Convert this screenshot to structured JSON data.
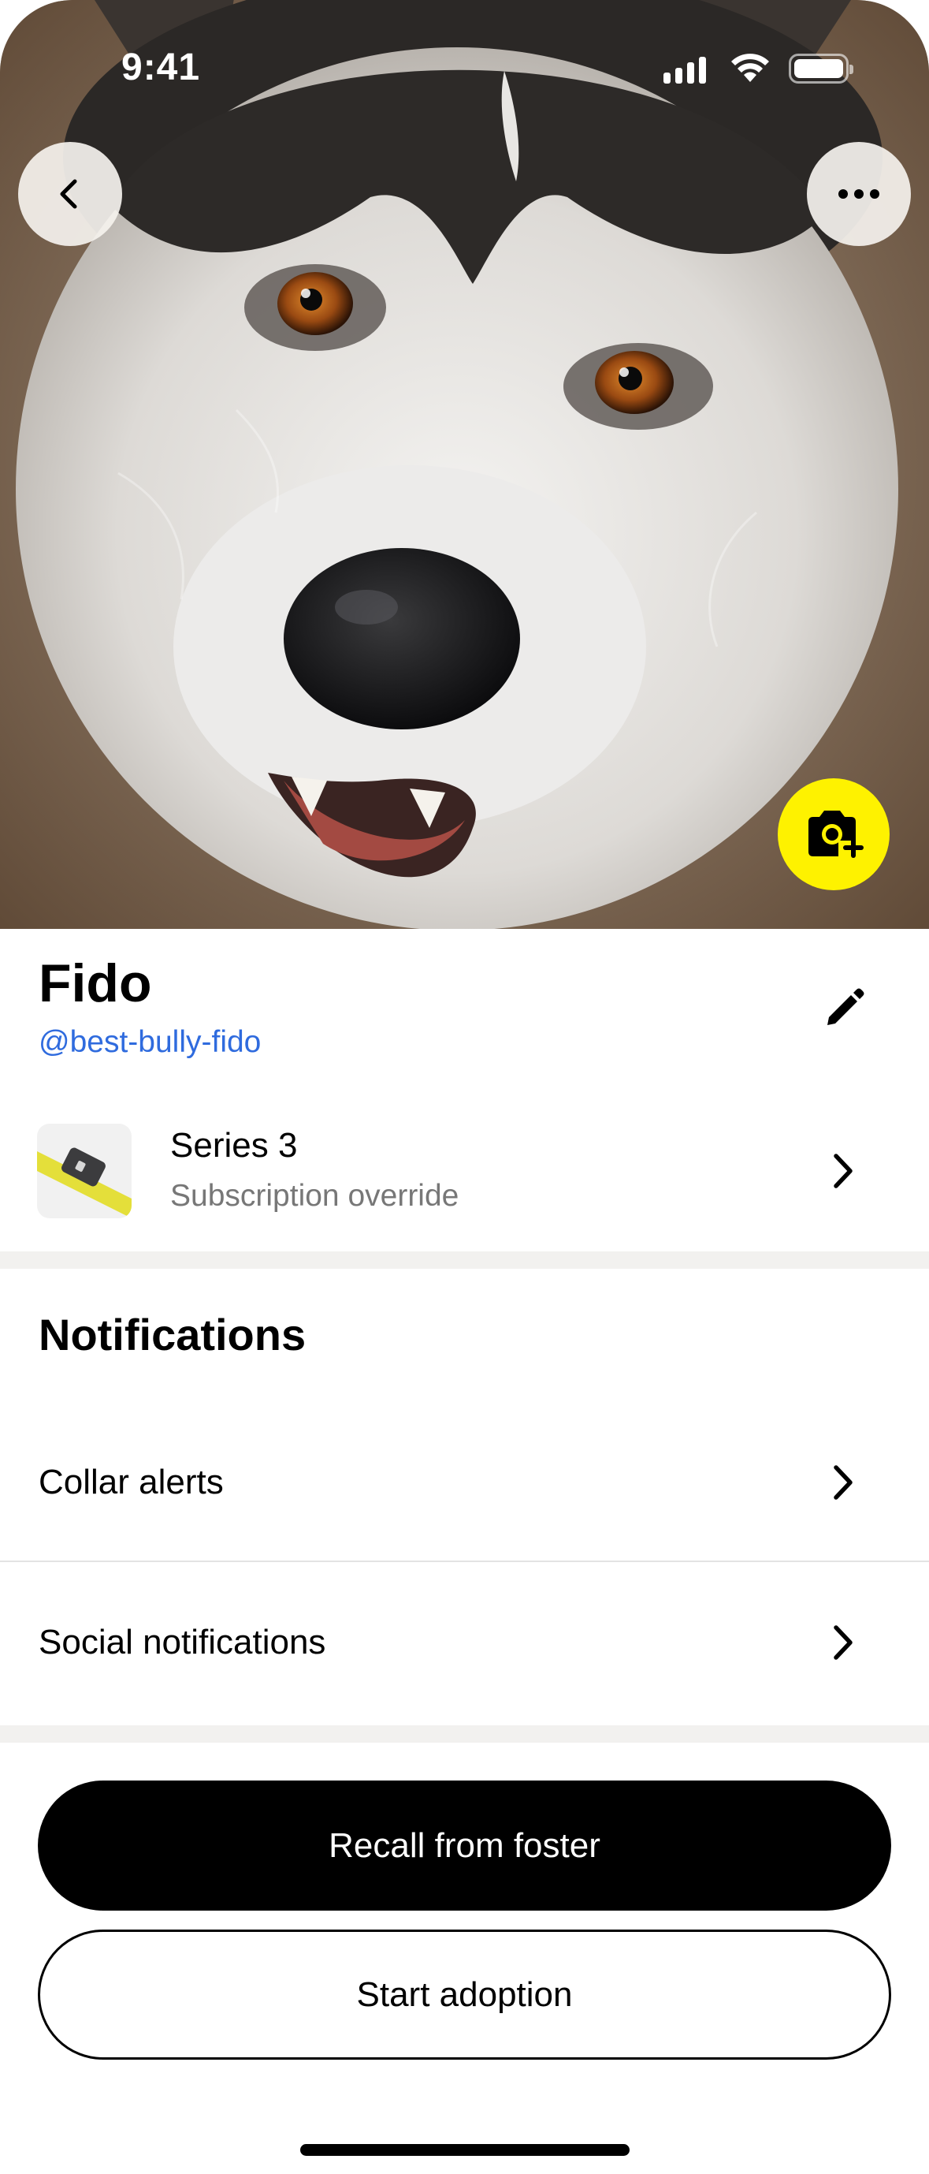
{
  "status_bar": {
    "time": "9:41"
  },
  "hero": {
    "photo": "husky-dog-photo"
  },
  "header": {
    "back_icon": "chevron-left-icon",
    "more_icon": "ellipsis-icon",
    "camera_icon": "camera-plus-icon"
  },
  "profile": {
    "name": "Fido",
    "handle": "@best-bully-fido",
    "edit_icon": "pencil-icon"
  },
  "device": {
    "title": "Series 3",
    "subtitle": "Subscription override"
  },
  "notifications": {
    "title": "Notifications",
    "items": [
      {
        "label": "Collar alerts"
      },
      {
        "label": "Social notifications"
      }
    ]
  },
  "actions": {
    "primary_label": "Recall from foster",
    "secondary_label": "Start adoption"
  },
  "colors": {
    "accent_yellow": "#fef200",
    "link_blue": "#2f6bde",
    "band_gray": "#f2f1ef"
  }
}
